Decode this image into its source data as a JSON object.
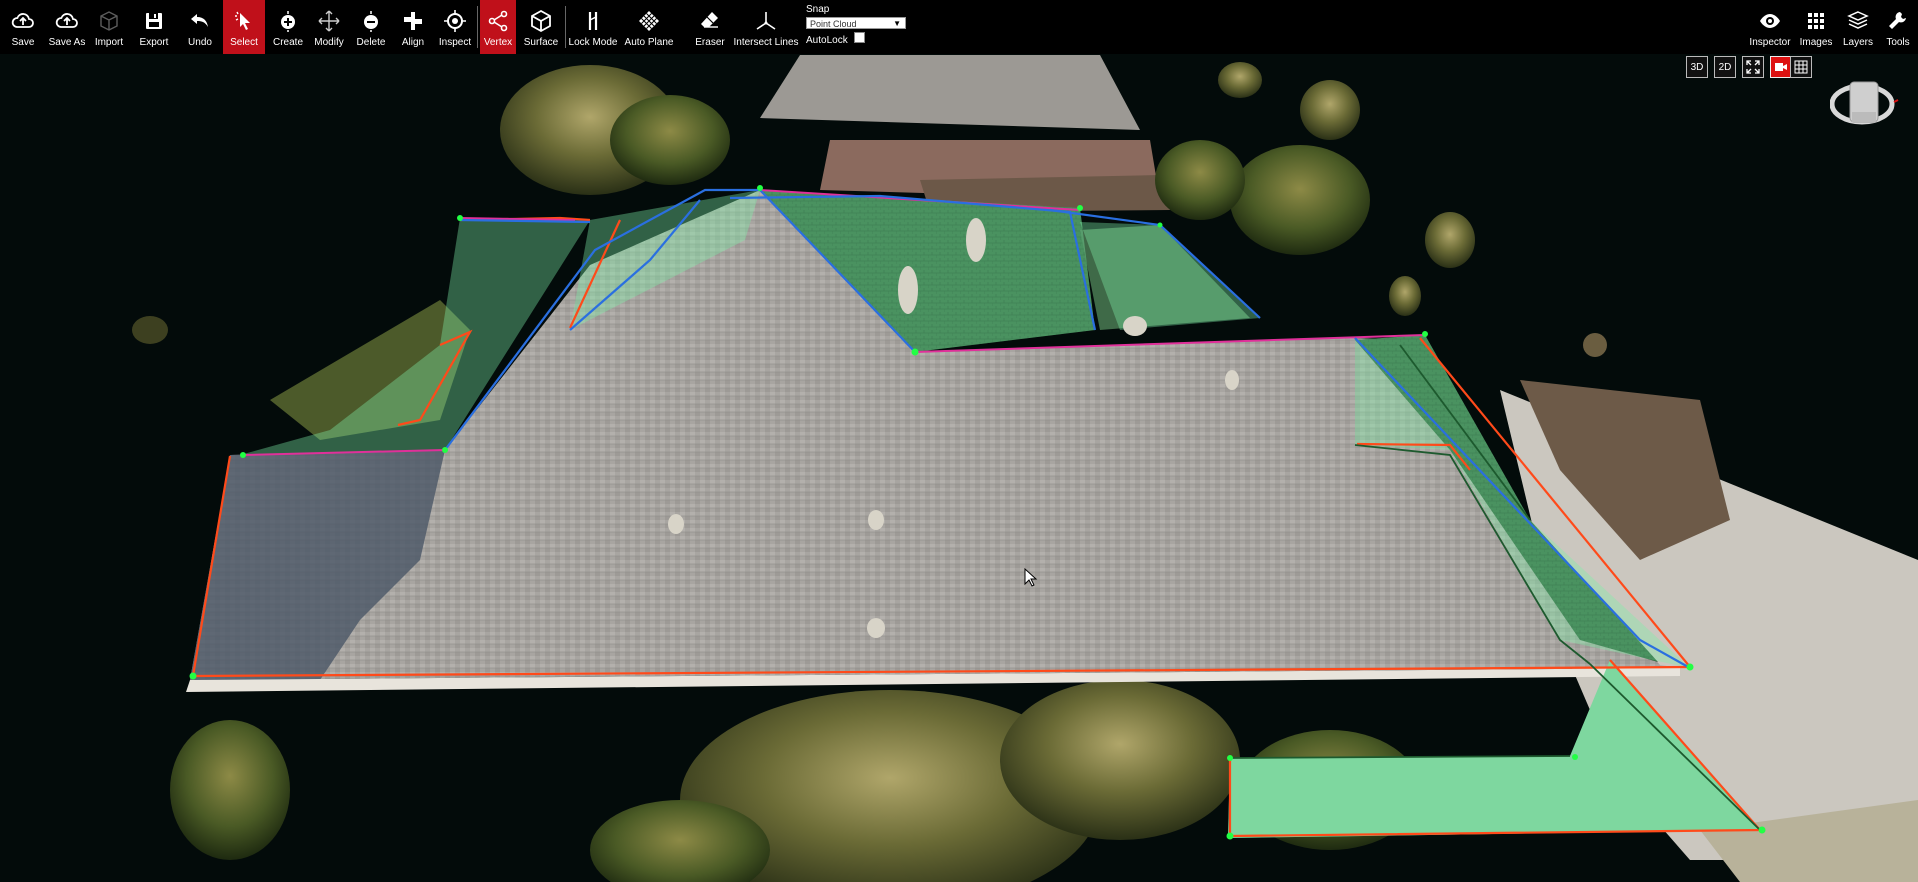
{
  "toolbar": {
    "buttons": [
      {
        "id": "save",
        "label": "Save",
        "icon": "cloud-upload-icon"
      },
      {
        "id": "save_as",
        "label": "Save As",
        "icon": "cloud-upload-icon"
      },
      {
        "id": "import",
        "label": "Import",
        "icon": "box-outline-icon"
      },
      {
        "id": "export",
        "label": "Export",
        "icon": "floppy-disk-icon"
      },
      {
        "id": "undo",
        "label": "Undo",
        "icon": "undo-arrow-icon"
      },
      {
        "id": "select",
        "label": "Select",
        "icon": "pointer-icon",
        "active": true
      },
      {
        "id": "create",
        "label": "Create",
        "icon": "plus-circle-icon"
      },
      {
        "id": "modify",
        "label": "Modify",
        "icon": "move-arrows-icon"
      },
      {
        "id": "delete",
        "label": "Delete",
        "icon": "minus-circle-icon"
      },
      {
        "id": "align",
        "label": "Align",
        "icon": "align-icon"
      },
      {
        "id": "inspect",
        "label": "Inspect",
        "icon": "crosshair-icon"
      },
      {
        "id": "vertex",
        "label": "Vertex",
        "icon": "vertex-share-icon",
        "active": true
      },
      {
        "id": "surface",
        "label": "Surface",
        "icon": "cube-icon"
      },
      {
        "id": "lock_mode",
        "label": "Lock Mode",
        "icon": "lock-mode-icon"
      },
      {
        "id": "auto_plane",
        "label": "Auto Plane",
        "icon": "diamond-grid-icon"
      },
      {
        "id": "eraser",
        "label": "Eraser",
        "icon": "eraser-icon"
      },
      {
        "id": "intersect_lines",
        "label": "Intersect Lines",
        "icon": "intersect-axes-icon"
      }
    ],
    "snap": {
      "title": "Snap",
      "value": "Point Cloud",
      "autolock_label": "AutoLock",
      "autolock_checked": false
    },
    "right_buttons": [
      {
        "id": "inspector",
        "label": "Inspector",
        "icon": "eye-icon"
      },
      {
        "id": "images",
        "label": "Images",
        "icon": "grid-icon"
      },
      {
        "id": "layers",
        "label": "Layers",
        "icon": "layers-icon"
      },
      {
        "id": "tools",
        "label": "Tools",
        "icon": "wrench-icon"
      }
    ]
  },
  "view_controls": {
    "btn_3d": "3D",
    "btn_2d": "2D"
  },
  "colors": {
    "accent_active": "#c0101a",
    "edge_blue": "#2a6fe0",
    "edge_orange": "#ff4a1a",
    "edge_pink": "#e0309a",
    "plane_fill": "#6fe39a",
    "vertex_green": "#22ff44",
    "roof_grey": "#a9a6a2",
    "background": "#000000"
  }
}
